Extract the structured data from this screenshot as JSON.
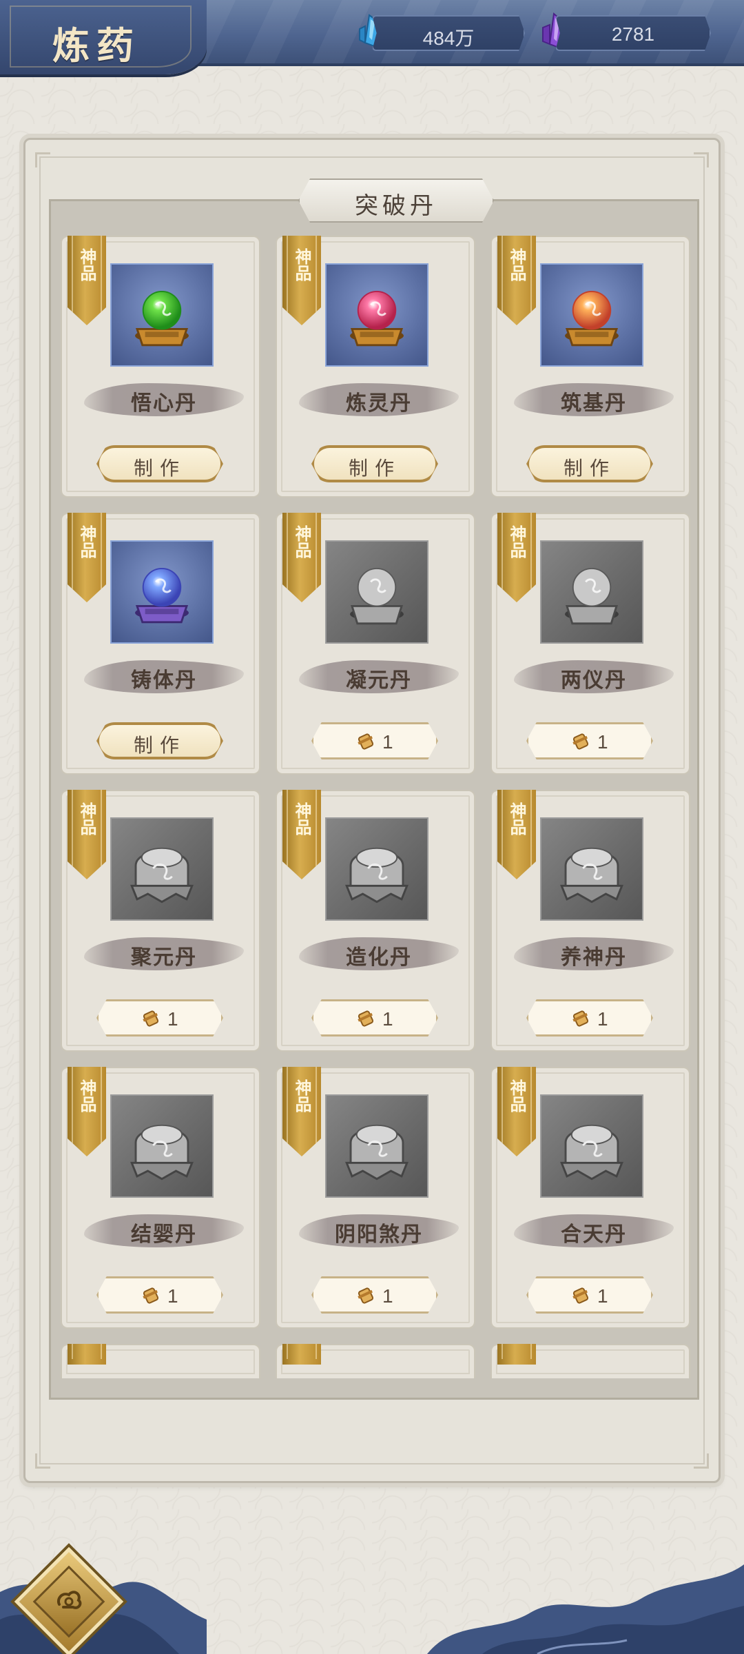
{
  "header": {
    "title": "炼药",
    "currencies": [
      {
        "icon": "blue-crystal-icon",
        "value": "484万"
      },
      {
        "icon": "purple-crystal-icon",
        "value": "2781"
      }
    ]
  },
  "panel": {
    "section_title": "突破丹"
  },
  "items": [
    {
      "rank": "神品",
      "name": "悟心丹",
      "icon": "green-pill-icon",
      "unlocked": true,
      "action": "制作"
    },
    {
      "rank": "神品",
      "name": "炼灵丹",
      "icon": "red-pill-icon",
      "unlocked": true,
      "action": "制作"
    },
    {
      "rank": "神品",
      "name": "筑基丹",
      "icon": "orange-pill-icon",
      "unlocked": true,
      "action": "制作"
    },
    {
      "rank": "神品",
      "name": "铸体丹",
      "icon": "blue-pill-icon",
      "unlocked": true,
      "action": "制作"
    },
    {
      "rank": "神品",
      "name": "凝元丹",
      "icon": "gray-pill-icon",
      "unlocked": false,
      "cost": "1"
    },
    {
      "rank": "神品",
      "name": "两仪丹",
      "icon": "gray-pill-icon",
      "unlocked": false,
      "cost": "1"
    },
    {
      "rank": "神品",
      "name": "聚元丹",
      "icon": "gray-cauldron-icon",
      "unlocked": false,
      "cost": "1"
    },
    {
      "rank": "神品",
      "name": "造化丹",
      "icon": "gray-cauldron-icon",
      "unlocked": false,
      "cost": "1"
    },
    {
      "rank": "神品",
      "name": "养神丹",
      "icon": "gray-cauldron-icon",
      "unlocked": false,
      "cost": "1"
    },
    {
      "rank": "神品",
      "name": "结婴丹",
      "icon": "gray-cauldron-icon",
      "unlocked": false,
      "cost": "1"
    },
    {
      "rank": "神品",
      "name": "阴阳煞丹",
      "icon": "gray-cauldron-icon",
      "unlocked": false,
      "cost": "1"
    },
    {
      "rank": "神品",
      "name": "合天丹",
      "icon": "gray-cauldron-icon",
      "unlocked": false,
      "cost": "1"
    }
  ],
  "colors": {
    "header_blue": "#4f6590",
    "gold": "#c79a3e",
    "panel_bg": "#e6e3da"
  }
}
